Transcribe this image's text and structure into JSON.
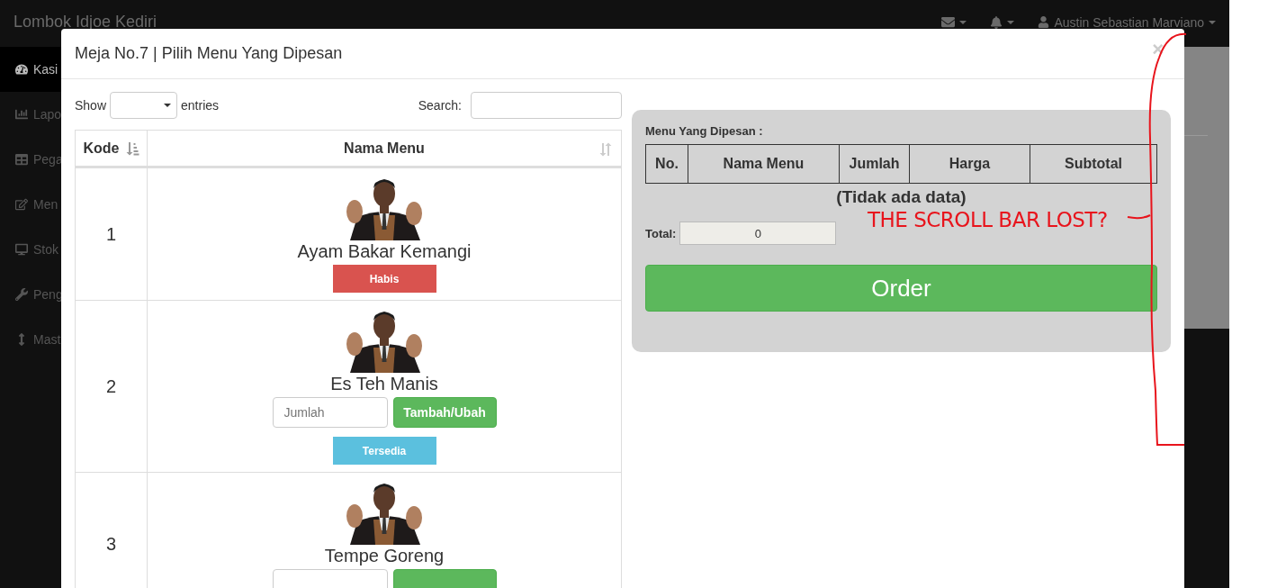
{
  "navbar": {
    "brand": "Lombok Idjoe Kediri",
    "user": "Austin Sebastian Marviano"
  },
  "sidebar": {
    "items": [
      {
        "label": "Kasi",
        "selected": true
      },
      {
        "label": "Lapo",
        "selected": false
      },
      {
        "label": "Pega",
        "selected": false
      },
      {
        "label": "Men",
        "selected": false
      },
      {
        "label": "Stok",
        "selected": false
      },
      {
        "label": "Peng",
        "selected": false
      },
      {
        "label": "Mast",
        "selected": false
      }
    ]
  },
  "modal": {
    "title": "Meja No.7 | Pilih Menu Yang Dipesan",
    "close": "×",
    "menu_table": {
      "show_label": "Show",
      "entries_label": "entries",
      "search_label": "Search:",
      "columns": [
        {
          "label": "Kode",
          "sorted": true
        },
        {
          "label": "Nama Menu",
          "sorted": false
        }
      ],
      "rows": [
        {
          "kode": "1",
          "name": "Ayam Bakar Kemangi",
          "has_form": false,
          "status": {
            "label": "Habis",
            "kind": "danger"
          }
        },
        {
          "kode": "2",
          "name": "Es Teh Manis",
          "has_form": true,
          "quantity_placeholder": "Jumlah",
          "add_button": "Tambah/Ubah",
          "status": {
            "label": "Tersedia",
            "kind": "info"
          }
        },
        {
          "kode": "3",
          "name": "Tempe Goreng",
          "has_form": true
        }
      ]
    },
    "order_panel": {
      "heading": "Menu Yang Dipesan :",
      "columns": [
        "No.",
        "Nama Menu",
        "Jumlah",
        "Harga",
        "Subtotal"
      ],
      "empty_text": "(Tidak ada data)",
      "total_label": "Total:",
      "total_value": "0",
      "order_button": "Order"
    }
  },
  "annotation": {
    "text": "THE SCROLL BAR LOST?"
  }
}
